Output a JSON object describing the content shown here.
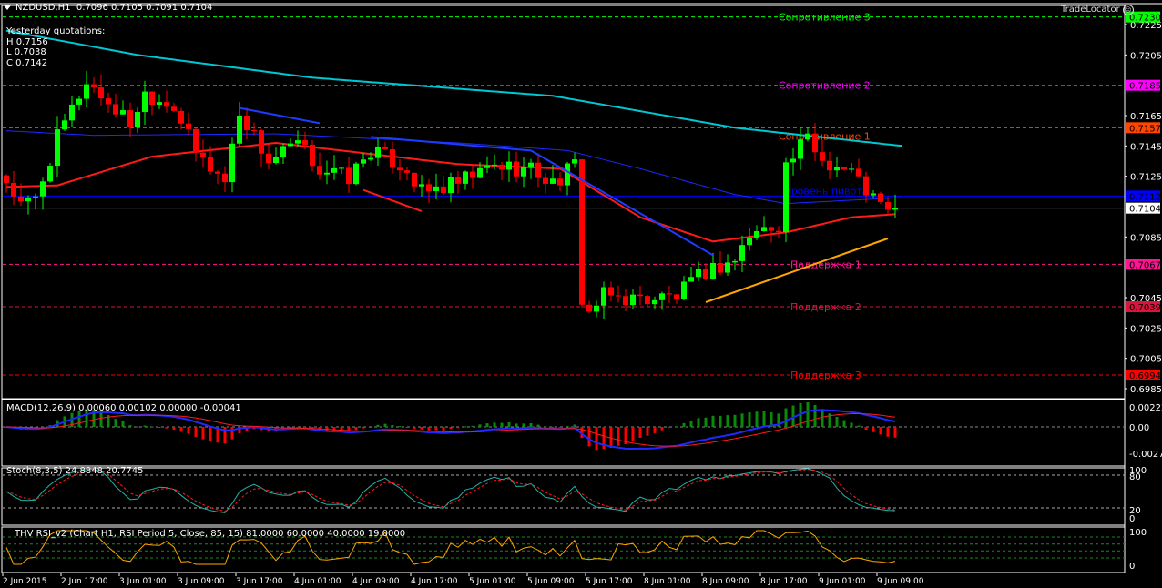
{
  "header": {
    "symbol": "NZDUSD,H1",
    "ohlc": "0.7096 0.7105 0.7091 0.7104",
    "yesterday_title": "Yesterday quotations:",
    "yesterday_high": "H 0.7156",
    "yesterday_low": "L 0.7038",
    "yesterday_close": "C 0.7142",
    "trade_locator": "TradeLocator"
  },
  "indicators": {
    "macd_label": "MACD(12,26,9) 0.00060 0.00102 0.00000 -0.00041",
    "stoch_label": "Stoch(8,3,5) 24.8848 20.7745",
    "rsi_label": "THV RSI_v2   (Chart H1,  RSI Period 5,  Close,  85,  15)  81.0000 60.0000 40.0000 19.0000"
  },
  "colors": {
    "bull": "#00ff00",
    "bear": "#ff0000",
    "ma_slow": "#00c8d2",
    "ma_mid": "#1e28ff",
    "ma_fast": "#ff1a1a",
    "trend_blue": "#1e3cff",
    "trend_orange": "#ffa500",
    "trend_red": "#ff1a1a",
    "grid": "#ffffff"
  },
  "chart_data": {
    "type": "candlestick",
    "symbol": "NZDUSD",
    "timeframe": "H1",
    "ylim": [
      0.698,
      0.724
    ],
    "y_ticks": [
      "0.7225",
      "0.7205",
      "0.7165",
      "0.7145",
      "0.7125",
      "0.7085",
      "0.7045",
      "0.7025",
      "0.7005",
      "0.6985"
    ],
    "x_ticks": [
      {
        "bar": 0,
        "label": "2 Jun 2015"
      },
      {
        "bar": 8,
        "label": "2 Jun 17:00"
      },
      {
        "bar": 16,
        "label": "3 Jun 01:00"
      },
      {
        "bar": 24,
        "label": "3 Jun 09:00"
      },
      {
        "bar": 32,
        "label": "3 Jun 17:00"
      },
      {
        "bar": 40,
        "label": "4 Jun 01:00"
      },
      {
        "bar": 48,
        "label": "4 Jun 09:00"
      },
      {
        "bar": 56,
        "label": "4 Jun 17:00"
      },
      {
        "bar": 64,
        "label": "5 Jun 01:00"
      },
      {
        "bar": 72,
        "label": "5 Jun 09:00"
      },
      {
        "bar": 80,
        "label": "5 Jun 17:00"
      },
      {
        "bar": 88,
        "label": "8 Jun 01:00"
      },
      {
        "bar": 96,
        "label": "8 Jun 09:00"
      },
      {
        "bar": 104,
        "label": "8 Jun 17:00"
      },
      {
        "bar": 112,
        "label": "9 Jun 01:00"
      },
      {
        "bar": 120,
        "label": "9 Jun 09:00"
      }
    ],
    "close_path": [
      [
        0,
        0.7122
      ],
      [
        2,
        0.7105
      ],
      [
        4,
        0.711
      ],
      [
        7,
        0.715
      ],
      [
        11,
        0.7188
      ],
      [
        13,
        0.7178
      ],
      [
        17,
        0.716
      ],
      [
        19,
        0.718
      ],
      [
        23,
        0.7172
      ],
      [
        26,
        0.714
      ],
      [
        30,
        0.7122
      ],
      [
        32,
        0.7168
      ],
      [
        36,
        0.7135
      ],
      [
        40,
        0.7146
      ],
      [
        43,
        0.713
      ],
      [
        47,
        0.7124
      ],
      [
        50,
        0.7142
      ],
      [
        55,
        0.713
      ],
      [
        57,
        0.7114
      ],
      [
        62,
        0.712
      ],
      [
        67,
        0.7132
      ],
      [
        72,
        0.713
      ],
      [
        75,
        0.712
      ],
      [
        78,
        0.7132
      ],
      [
        79,
        0.7045
      ],
      [
        80,
        0.7035
      ],
      [
        82,
        0.7046
      ],
      [
        87,
        0.7044
      ],
      [
        92,
        0.7046
      ],
      [
        96,
        0.7062
      ],
      [
        100,
        0.707
      ],
      [
        102,
        0.7086
      ],
      [
        106,
        0.7094
      ],
      [
        107,
        0.7132
      ],
      [
        110,
        0.715
      ],
      [
        112,
        0.7136
      ],
      [
        116,
        0.7128
      ],
      [
        118,
        0.7116
      ],
      [
        121,
        0.71
      ],
      [
        122,
        0.7104
      ]
    ],
    "moving_averages": [
      {
        "name": "slow",
        "color": "#00c8d2",
        "points": [
          [
            0,
            0.7221
          ],
          [
            18,
            0.7205
          ],
          [
            42,
            0.719
          ],
          [
            75,
            0.7178
          ],
          [
            100,
            0.7157
          ],
          [
            123,
            0.7145
          ]
        ]
      },
      {
        "name": "mid",
        "color": "#1e28ff",
        "points": [
          [
            0,
            0.7155
          ],
          [
            12,
            0.7152
          ],
          [
            37,
            0.7153
          ],
          [
            62,
            0.7147
          ],
          [
            77,
            0.7142
          ],
          [
            87,
            0.713
          ],
          [
            100,
            0.7113
          ],
          [
            107,
            0.7107
          ],
          [
            123,
            0.7111
          ]
        ]
      },
      {
        "name": "fast",
        "color": "#ff1a1a",
        "points": [
          [
            0,
            0.7118
          ],
          [
            7,
            0.7119
          ],
          [
            20,
            0.7138
          ],
          [
            37,
            0.7147
          ],
          [
            62,
            0.7133
          ],
          [
            76,
            0.713
          ],
          [
            87,
            0.7098
          ],
          [
            97,
            0.7082
          ],
          [
            107,
            0.7088
          ],
          [
            116,
            0.7098
          ],
          [
            122,
            0.71
          ]
        ]
      }
    ],
    "levels": [
      {
        "price": 0.723,
        "label": "Сопротивление 3",
        "tag": "0.7230",
        "color": "#00ff00",
        "text": "#000000"
      },
      {
        "price": 0.7185,
        "label": "Сопротивление 2",
        "tag": "0.7185",
        "color": "#ff00ff",
        "text": "#000000"
      },
      {
        "price": 0.7157,
        "label": "Сопротивление 1",
        "tag": "0.7157",
        "color": "#ff4500",
        "text": "#000000"
      },
      {
        "price": 0.7112,
        "label": "Уровень пивота",
        "tag": "0.7112",
        "color": "#0000ff",
        "text": "#000000"
      },
      {
        "price": 0.7067,
        "label": "Поддержка 1",
        "tag": "0.7067",
        "color": "#ff1493",
        "text": "#000000"
      },
      {
        "price": 0.7039,
        "label": "Поддержка 2",
        "tag": "0.7039",
        "color": "#dc143c",
        "text": "#000000"
      },
      {
        "price": 0.6994,
        "label": "Поддержка 3",
        "tag": "0.6994",
        "color": "#ff0000",
        "text": "#000000"
      }
    ],
    "current_price": {
      "price": 0.7104,
      "tag": "0.7104"
    },
    "trendlines": [
      {
        "color": "#1e3cff",
        "from": [
          32,
          0.717
        ],
        "to": [
          43,
          0.716
        ]
      },
      {
        "color": "#ff1a1a",
        "from": [
          49,
          0.7116
        ],
        "to": [
          57,
          0.7102
        ]
      },
      {
        "color": "#1e3cff",
        "from": [
          50,
          0.7151
        ],
        "to": [
          72,
          0.7142
        ]
      },
      {
        "color": "#1e3cff",
        "from": [
          72,
          0.7142
        ],
        "to": [
          97,
          0.7073
        ]
      },
      {
        "color": "#ffa500",
        "from": [
          96,
          0.7042
        ],
        "to": [
          121,
          0.7084
        ]
      }
    ],
    "macd": {
      "fast": 12,
      "slow": 26,
      "signal": 9,
      "ticks": [
        "0.00222",
        "0.00",
        "-0.00272"
      ],
      "range": [
        -0.00272,
        0.00222
      ]
    },
    "stoch": {
      "k": 8,
      "d": 3,
      "slowing": 5,
      "levels": [
        80,
        20
      ],
      "ticks": [
        "100",
        "80",
        "20",
        "0"
      ]
    },
    "rsi": {
      "period": 5,
      "levels": [
        81,
        60,
        40,
        19
      ],
      "ticks": [
        "100",
        "0"
      ]
    }
  }
}
